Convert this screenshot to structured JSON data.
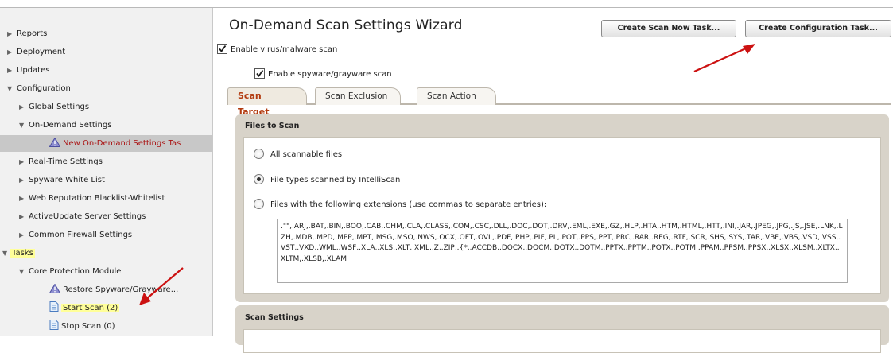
{
  "sidebar": {
    "items": [
      {
        "label": "Reports",
        "arrow": "▶"
      },
      {
        "label": "Deployment",
        "arrow": "▶"
      },
      {
        "label": "Updates",
        "arrow": "▶"
      },
      {
        "label": "Configuration",
        "arrow": "▼"
      },
      {
        "label": "Global Settings",
        "arrow": "▶"
      },
      {
        "label": "On-Demand Settings",
        "arrow": "▼"
      },
      {
        "label": "New On-Demand Settings Tas"
      },
      {
        "label": "Real-Time Settings",
        "arrow": "▶"
      },
      {
        "label": "Spyware White List",
        "arrow": "▶"
      },
      {
        "label": "Web Reputation Blacklist-Whitelist",
        "arrow": "▶"
      },
      {
        "label": "ActiveUpdate Server Settings",
        "arrow": "▶"
      },
      {
        "label": "Common Firewall Settings",
        "arrow": "▶"
      },
      {
        "label": "Tasks",
        "arrow": "▼"
      },
      {
        "label": "Core Protection Module",
        "arrow": "▼"
      },
      {
        "label": "Restore Spyware/Grayware..."
      },
      {
        "label": "Start Scan (2)"
      },
      {
        "label": "Stop Scan (0)"
      }
    ]
  },
  "header": {
    "title": "On-Demand Scan Settings Wizard",
    "create_scan_now": "Create Scan Now Task...",
    "create_configuration": "Create Configuration Task..."
  },
  "options": {
    "enable_virus": "Enable virus/malware scan",
    "enable_spyware": "Enable spyware/grayware scan"
  },
  "tabs": [
    {
      "label": "Scan Target"
    },
    {
      "label": "Scan Exclusion"
    },
    {
      "label": "Scan Action"
    }
  ],
  "files_to_scan": {
    "title": "Files to Scan",
    "all_files": "All scannable files",
    "intelliscan": "File types scanned by IntelliScan",
    "extensions_label": "Files with the following extensions (use commas to separate entries):",
    "extensions_value": ".\"\",.ARJ,.BAT,.BIN,.BOO,.CAB,.CHM,.CLA,.CLASS,.COM,.CSC,.DLL,.DOC,.DOT,.DRV,.EML,.EXE,.GZ,.HLP,.HTA,.HTM,.HTML,.HTT,.INI,.JAR,.JPEG,.JPG,.JS,.JSE,.LNK,.LZH,.MDB,.MPD,.MPP,.MPT,.MSG,.MSO,.NWS,.OCX,.OFT,.OVL,.PDF,.PHP,.PIF,.PL,.POT,.PPS,.PPT,.PRC,.RAR,.REG,.RTF,.SCR,.SHS,.SYS,.TAR,.VBE,.VBS,.VSD,.VSS,.VST,.VXD,.WML,.WSF,.XLA,.XLS,.XLT,.XML,.Z,.ZIP,.{*,.ACCDB,.DOCX,.DOCM,.DOTX,.DOTM,.PPTX,.PPTM,.POTX,.POTM,.PPAM,.PPSM,.PPSX,.XLSX,.XLSM,.XLTX,.XLTM,.XLSB,.XLAM"
  },
  "scan_settings": {
    "title": "Scan Settings"
  },
  "colors": {
    "active_tab_text": "#b23a0e",
    "highlight": "#ffff99",
    "annotation_arrow": "#cc1111"
  }
}
